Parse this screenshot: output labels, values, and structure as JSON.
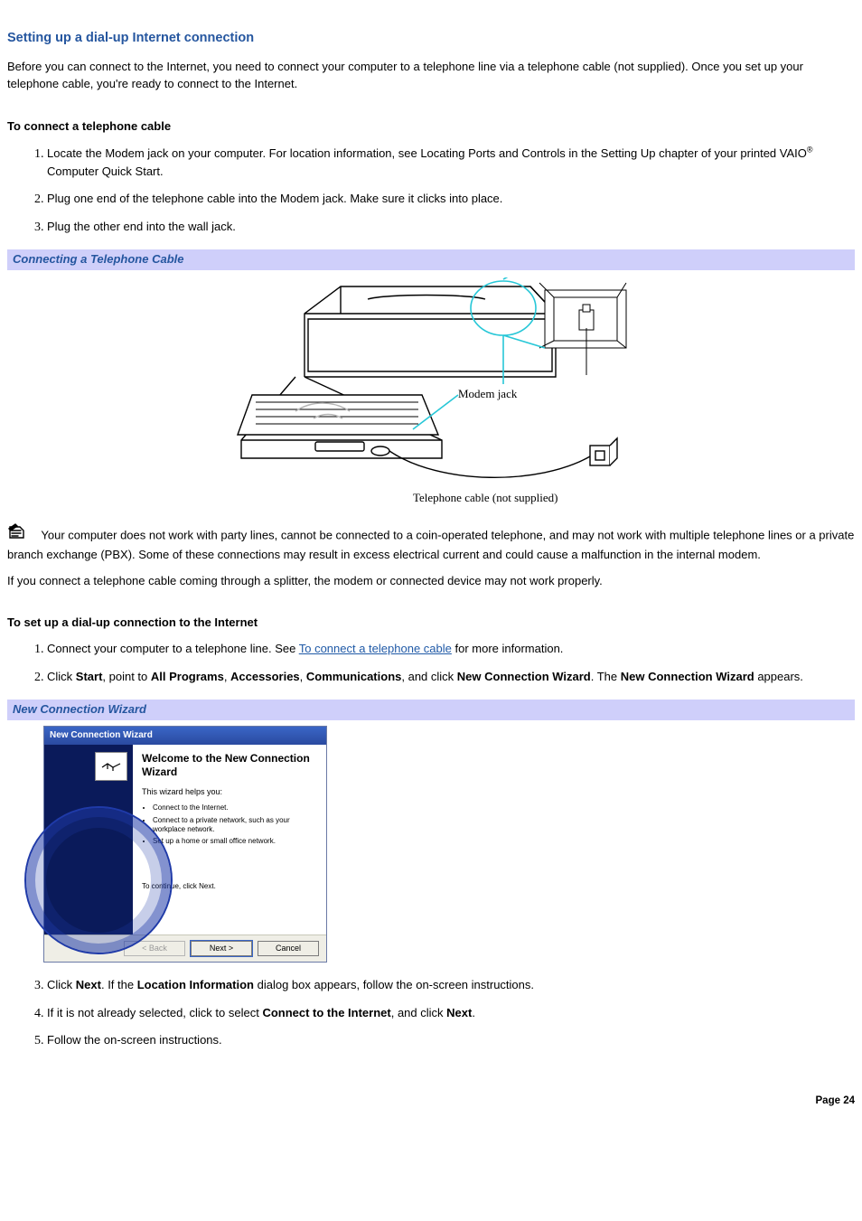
{
  "title": "Setting up a dial-up Internet connection",
  "intro": "Before you can connect to the Internet, you need to connect your computer to a telephone line via a telephone cable (not supplied). Once you set up your telephone cable, you're ready to connect to the Internet.",
  "sectionA": {
    "heading": "To connect a telephone cable",
    "steps": [
      {
        "pre": "Locate the Modem jack on your computer. For location information, see Locating Ports and Controls in the Setting Up chapter of your printed VAIO",
        "reg": "®",
        "post": " Computer Quick Start."
      },
      {
        "pre": "Plug one end of the telephone cable into the Modem jack. Make sure it clicks into place."
      },
      {
        "pre": "Plug the other end into the wall jack."
      }
    ]
  },
  "banner1": "Connecting a Telephone Cable",
  "illustration": {
    "modem_jack_label": "Modem jack",
    "cable_caption": "Telephone cable (not supplied)"
  },
  "note1": "Your computer does not work with party lines, cannot be connected to a coin-operated telephone, and may not work with multiple telephone lines or a private branch exchange (PBX). Some of these connections may result in excess electrical current and could cause a malfunction in the internal modem.",
  "note2": "If you connect a telephone cable coming through a splitter, the modem or connected device may not work properly.",
  "sectionB": {
    "heading": "To set up a dial-up connection to the Internet",
    "steps": [
      {
        "pre": "Connect your computer to a telephone line. See ",
        "link": "To connect a telephone cable",
        "post": " for more information."
      },
      {
        "pre": "Click ",
        "b1": "Start",
        "m1": ", point to ",
        "b2": "All Programs",
        "m2": ", ",
        "b3": "Accessories",
        "m3": ", ",
        "b4": "Communications",
        "m4": ", and click ",
        "b5": "New Connection Wizard",
        "m5": ". The ",
        "b6": "New Connection Wizard",
        "m6": " appears."
      },
      {
        "pre": "Click ",
        "b1": "Next",
        "m1": ". If the ",
        "b2": "Location Information",
        "m2": " dialog box appears, follow the on-screen instructions."
      },
      {
        "pre": "If it is not already selected, click to select ",
        "b1": "Connect to the Internet",
        "m1": ", and click ",
        "b2": "Next",
        "m2": "."
      },
      {
        "pre": "Follow the on-screen instructions."
      }
    ]
  },
  "banner2": "New Connection Wizard",
  "wizard": {
    "title": "New Connection Wizard",
    "welcome": "Welcome to the New Connection Wizard",
    "helps": "This wizard helps you:",
    "bullets": [
      "Connect to the Internet.",
      "Connect to a private network, such as your workplace network.",
      "Set up a home or small office network."
    ],
    "continue": "To continue, click Next.",
    "buttons": {
      "back": "< Back",
      "next": "Next >",
      "cancel": "Cancel"
    }
  },
  "page_label": "Page 24"
}
